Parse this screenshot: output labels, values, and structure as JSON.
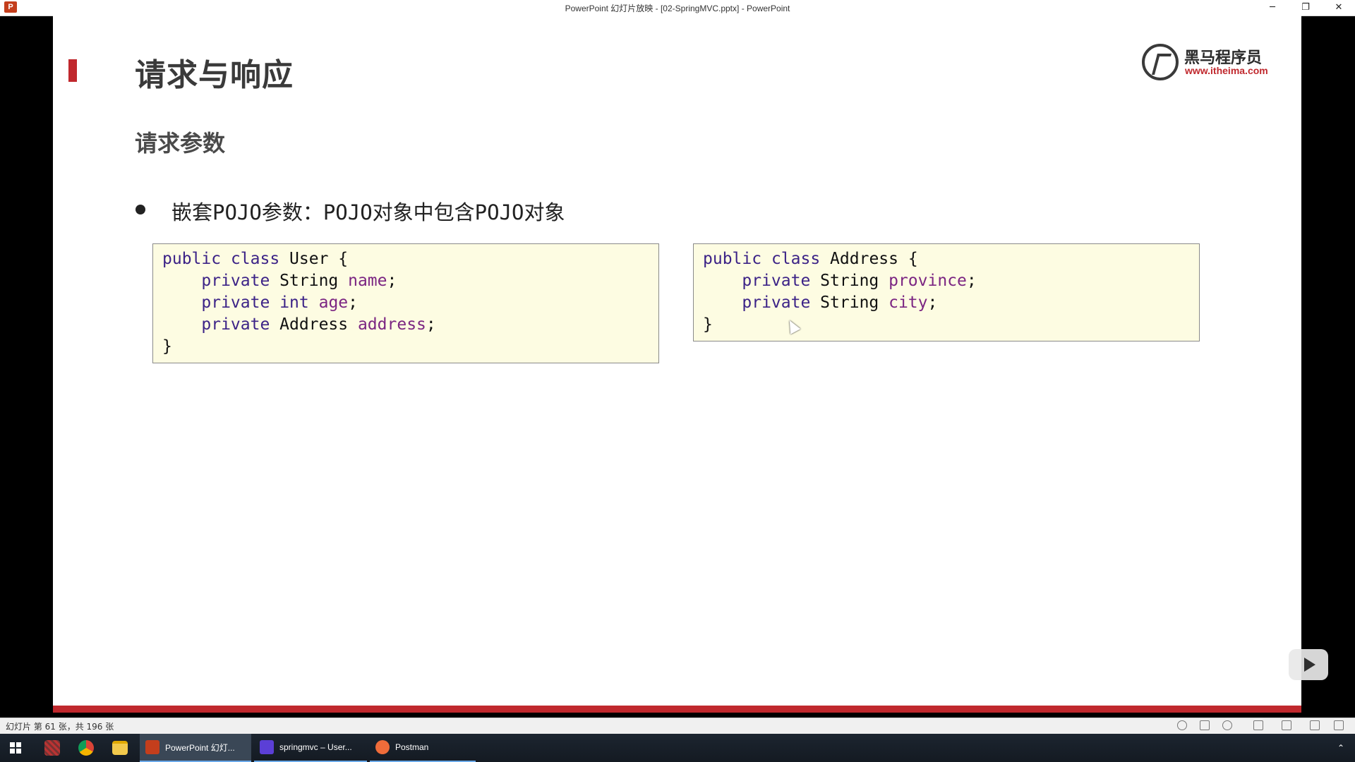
{
  "window": {
    "title": "PowerPoint 幻灯片放映 - [02-SpringMVC.pptx] - PowerPoint",
    "app_icon_label": "P",
    "minimize_glyph": "─",
    "restore_glyph": "❐",
    "close_glyph": "✕"
  },
  "slide": {
    "title": "请求与响应",
    "subtitle": "请求参数",
    "bullet": "嵌套POJO参数：POJO对象中包含POJO对象",
    "logo": {
      "name": "黑马程序员",
      "url": "www.itheima.com"
    },
    "code_user": [
      "public class User {",
      "    private String name;",
      "    private int age;",
      "    private Address address;",
      "}"
    ],
    "code_address": [
      "public class Address {",
      "    private String province;",
      "    private String city;",
      "}"
    ],
    "colors": {
      "accent": "#c0282d",
      "code_bg": "#fdfce2",
      "keyword": "#3c2387",
      "field": "#7b2582"
    }
  },
  "status_bar": {
    "slide_counter": "幻灯片 第 61 张，共 196 张"
  },
  "taskbar": {
    "apps": [
      {
        "label": "PowerPoint 幻灯...",
        "icon": "powerpoint-icon",
        "color": "#c43e1c",
        "active": true
      },
      {
        "label": "springmvc – User...",
        "icon": "intellij-icon",
        "color": "#5b3fd6",
        "active": false
      },
      {
        "label": "Postman",
        "icon": "postman-icon",
        "color": "#ef6c3a",
        "active": false
      }
    ],
    "pinned": [
      "settings-app-icon",
      "chrome-icon",
      "file-explorer-icon"
    ],
    "tray_glyph": "⌃"
  }
}
